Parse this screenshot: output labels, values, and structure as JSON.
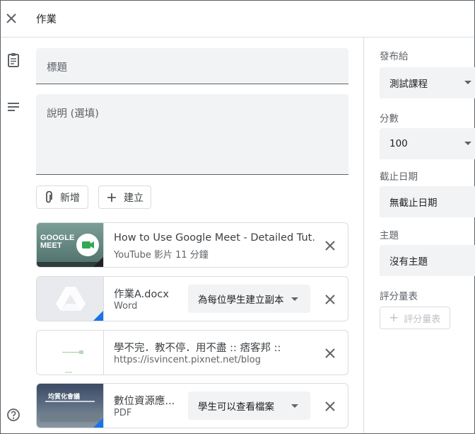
{
  "header": {
    "title": "作業",
    "close_icon": "close-icon"
  },
  "form": {
    "title_placeholder": "標題",
    "description_placeholder": "說明 (選填)",
    "add_button_label": "新增",
    "create_button_label": "建立"
  },
  "attachments": [
    {
      "title": "How to Use Google Meet - Detailed Tut...",
      "subtitle": "YouTube 影片 11 分鐘",
      "thumb_text_1": "GOOGLE",
      "thumb_text_2": "MEET"
    },
    {
      "title": "作業A.docx",
      "subtitle": "Word",
      "select_value": "為每位學生建立副本"
    },
    {
      "title": "學不完．教不停．用不盡 :: 痞客邦 ::",
      "subtitle": "https://isvincent.pixnet.net/blog"
    },
    {
      "title": "數位資源應...",
      "subtitle": "PDF",
      "select_value": "學生可以查看檔案",
      "thumb_text": "均質化會議"
    }
  ],
  "sidebar": {
    "assign_to_label": "發布給",
    "assign_to_value": "測試課程",
    "points_label": "分數",
    "points_value": "100",
    "due_label": "截止日期",
    "due_value": "無截止日期",
    "topic_label": "主題",
    "topic_value": "沒有主題",
    "rubric_label": "評分量表",
    "rubric_button_label": "評分量表"
  },
  "colors": {
    "accent": "#1a73e8",
    "field_bg": "#f1f3f4",
    "meet_green": "#34a853"
  }
}
